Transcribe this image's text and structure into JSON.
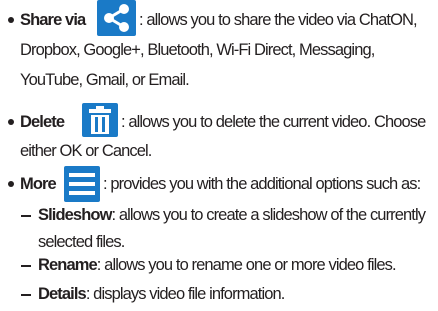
{
  "share": {
    "term": "Share via",
    "line1": ": allows you to share the video via ChatON,",
    "line2": "Dropbox, Google+, Bluetooth, Wi-Fi Direct, Messaging,",
    "line3": "YouTube, Gmail, or Email.",
    "icon": "share-icon"
  },
  "delete": {
    "term": "Delete",
    "line1": ": allows you to delete the current video. Choose",
    "line2": "either OK or Cancel.",
    "icon": "trash-icon"
  },
  "more": {
    "term": "More",
    "line1": ": provides you with the additional options such as:",
    "icon": "menu-icon",
    "subitems": [
      {
        "term": "Slideshow",
        "text1": ": allows you to create a slideshow of the currently",
        "text2": "selected files."
      },
      {
        "term": "Rename",
        "text1": ": allows you to rename one or more video files."
      },
      {
        "term": "Details",
        "text1": ": displays video file information."
      }
    ]
  },
  "colors": {
    "icon_bg": "#1a7ac7",
    "text": "#231f20"
  }
}
